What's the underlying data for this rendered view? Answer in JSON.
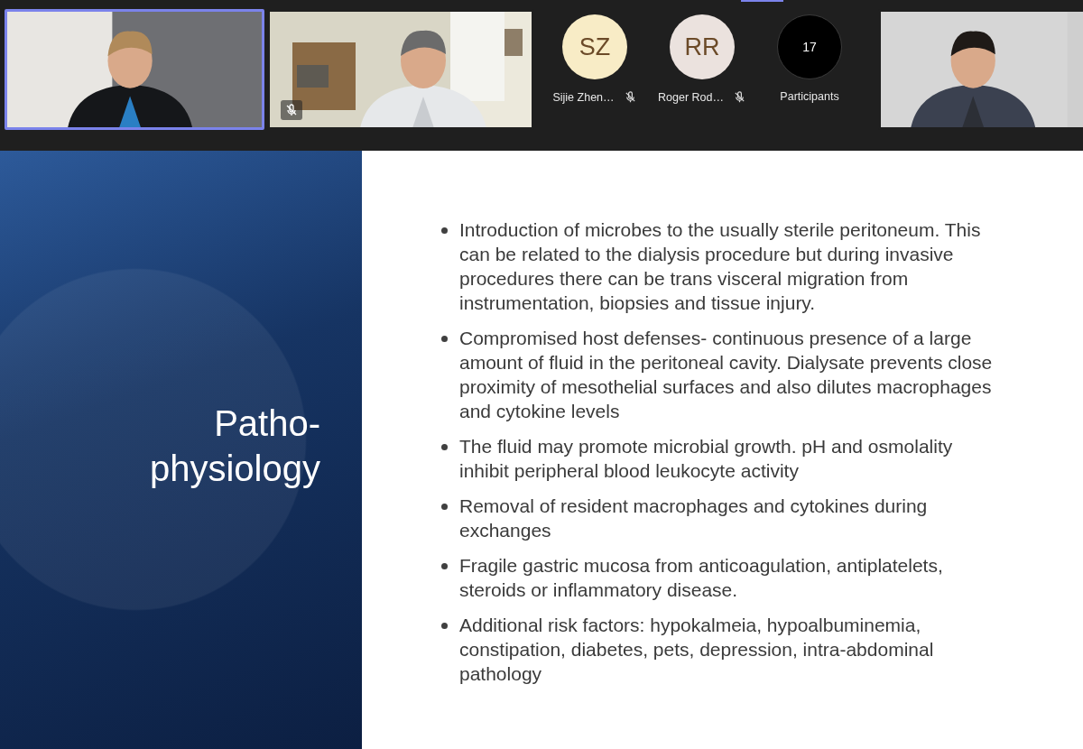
{
  "participants_strip": {
    "tiles": [
      {
        "kind": "video",
        "speaking": true,
        "muted": false
      },
      {
        "kind": "video",
        "speaking": false,
        "muted": true
      },
      {
        "kind": "avatar",
        "initials": "SZ",
        "name": "Sijie Zhen…",
        "muted": true,
        "color": "#f8ecc6"
      },
      {
        "kind": "avatar",
        "initials": "RR",
        "name": "Roger Rod…",
        "muted": true,
        "color": "#ebe2de"
      },
      {
        "kind": "count",
        "count": "17",
        "label": "Participants"
      },
      {
        "kind": "video",
        "speaking": false,
        "muted": false
      }
    ]
  },
  "slide": {
    "title": "Patho-physiology",
    "bullets": [
      "Introduction of microbes to the usually sterile peritoneum. This can be related to the dialysis procedure but during invasive procedures there can be trans visceral migration from instrumentation, biopsies and tissue injury.",
      "Compromised host defenses- continuous presence of a large amount of fluid in the peritoneal cavity. Dialysate prevents close proximity of mesothelial surfaces and also dilutes macrophages and cytokine levels",
      "The fluid may promote microbial growth. pH and osmolality inhibit peripheral blood leukocyte activity",
      "Removal of resident macrophages and cytokines during exchanges",
      "Fragile gastric mucosa from anticoagulation, antiplatelets, steroids or inflammatory disease.",
      "Additional risk factors: hypokalmeia, hypoalbuminemia, constipation, diabetes, pets, depression, intra-abdominal pathology"
    ]
  }
}
